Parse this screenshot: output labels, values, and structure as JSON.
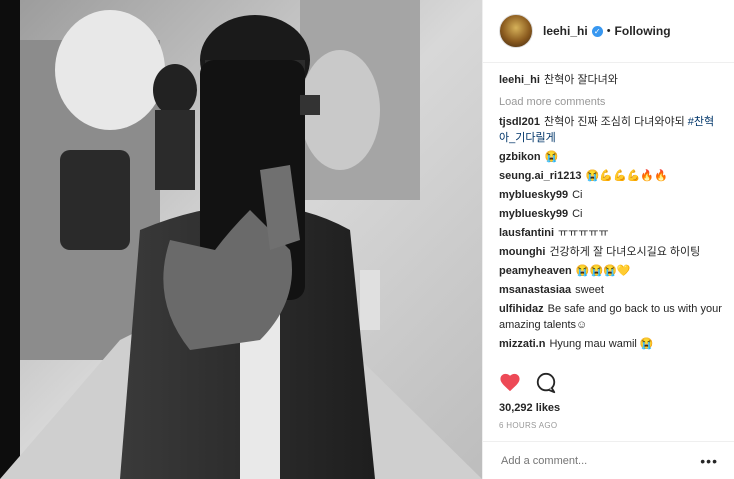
{
  "post": {
    "username": "leehi_hi",
    "follow_status": "Following",
    "separator": "•",
    "likes": "30,292 likes",
    "time": "6 HOURS AGO",
    "load_more": "Load more comments",
    "add_comment_placeholder": "Add a comment...",
    "more_icon": "•••",
    "verified_mark": "✓"
  },
  "comments": [
    {
      "user": "leehi_hi",
      "text": "찬혁아 잘다녀와"
    },
    {
      "user": "tjsdl201",
      "text": "찬혁아 진짜 조심히 다녀와야되",
      "tag": "#찬혁아_기다릴게"
    },
    {
      "user": "gzbikon",
      "text": "😭"
    },
    {
      "user": "seung.ai_ri1213",
      "text": "😭💪💪💪🔥🔥"
    },
    {
      "user": "mybluesky99",
      "text": "Ci"
    },
    {
      "user": "mybluesky99",
      "text": "Ci"
    },
    {
      "user": "lausfantini",
      "text": "ㅠㅠㅠㅠㅠ"
    },
    {
      "user": "mounghi",
      "text": "건강하게 잘 다녀오시길요 하이팅"
    },
    {
      "user": "peamyheaven",
      "text": "😭😭😭💛"
    },
    {
      "user": "msanastasiaa",
      "text": "sweet"
    },
    {
      "user": "ulfihidaz",
      "text": "Be safe and go back to us with your amazing talents☺"
    },
    {
      "user": "mizzati.n",
      "text": "Hyung mau wamil 😭"
    }
  ],
  "icons": {
    "like": "heart-icon",
    "comment": "comment-icon"
  },
  "colors": {
    "like": "#ed4956",
    "verified": "#3897f0",
    "muted": "#999999"
  }
}
